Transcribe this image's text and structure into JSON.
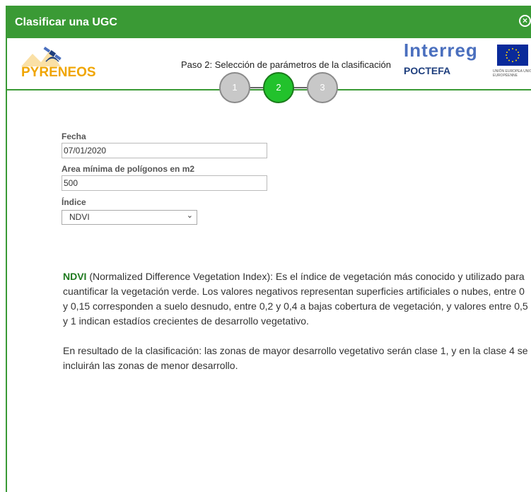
{
  "dialog": {
    "title": "Clasificar una UGC",
    "close_icon": "close-icon"
  },
  "header": {
    "logo_text_a": "PYREN",
    "logo_text_b": "EOS",
    "step_title": "Paso 2: Selección de parámetros de la clasificación",
    "steps": [
      "1",
      "2",
      "3"
    ],
    "active_step": 2,
    "interreg_name": "Interreg",
    "interreg_sub": "POCTEFA",
    "eu_text": "UNIÓN EUROPEA\nUNION EUROPÉENNE"
  },
  "form": {
    "date_label": "Fecha",
    "date_value": "07/01/2020",
    "area_label": "Area mínima de polígonos en m2",
    "area_value": "500",
    "index_label": "Índice",
    "index_value": "NDVI"
  },
  "description": {
    "abbr": "NDVI",
    "p1_rest": " (Normalized Difference Vegetation Index): Es el índice de vegetación más conocido y utilizado para cuantificar la vegetación verde. Los valores negativos representan superficies artificiales o nubes, entre 0 y 0,15 corresponden a suelo desnudo, entre 0,2 y 0,4 a bajas cobertura de vegetación, y valores entre 0,5 y 1 indican estadíos crecientes de desarrollo vegetativo.",
    "p2": "En resultado de la clasificación: las zonas de mayor desarrollo vegetativo serán clase 1, y en la clase 4 se incluirán las zonas de menor desarrollo."
  },
  "colors": {
    "accent_green": "#3a9a35",
    "active_step": "#22c22c",
    "interreg_blue": "#4a6fbe"
  }
}
